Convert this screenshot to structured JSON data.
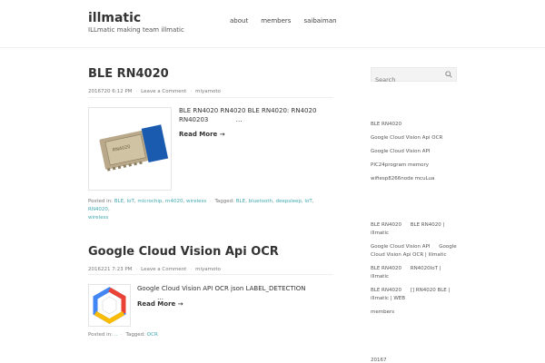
{
  "site": {
    "title": "illmatic",
    "description": "ILLmatic making team illmatic"
  },
  "nav": [
    {
      "label": "about"
    },
    {
      "label": "members"
    },
    {
      "label": "saibaiman"
    }
  ],
  "posts": [
    {
      "title": "BLE RN4020",
      "date": "2016720 6:12 PM",
      "comment": "Leave a Comment",
      "author": "miyamoto",
      "excerpt_1": "BLE RN4020 RN4020 BLE RN4020: RN4020",
      "excerpt_2": "RN40203",
      "excerpt_dots": "…",
      "more": "Read More →",
      "posted_in_label": "Posted in:",
      "categories": [
        "BLE",
        "IoT",
        "microchip",
        "rn4020",
        "wireless"
      ],
      "tagged_label": "Tagged:",
      "tags": [
        "BLE",
        "bluetooth",
        "deepsleep",
        "IoT",
        "RN4020",
        "wireless"
      ]
    },
    {
      "title": "Google Cloud Vision Api OCR",
      "date": "2016221 7:23 PM",
      "comment": "Leave a Comment",
      "author": "miyamoto",
      "excerpt_1": "Google Cloud Vision API OCR  json LABEL_DETECTION",
      "excerpt_dots": "…",
      "more": "Read More →",
      "posted_in_label": "Posted in:",
      "categories": [
        ".."
      ],
      "tagged_label": "Tagged:",
      "tags": [
        "OCR"
      ]
    }
  ],
  "sidebar": {
    "search_placeholder": "Search",
    "recent": [
      "BLE RN4020",
      "Google Cloud Vision Api OCR",
      "Google Cloud Vision API",
      "PIC24program memory",
      "wifiesp8266node mcuLua"
    ],
    "comments": [
      [
        "BLE RN4020",
        "BLE RN4020 |",
        "illmatic"
      ],
      [
        "Google Cloud Vision API",
        "Google",
        "Cloud Vision Api OCR | illmatic"
      ],
      [
        "BLE RN4020",
        "RN4020IoT |",
        "illmatic"
      ],
      [
        "BLE RN4020",
        "[] RN4020 BLE |",
        "illmatic | WEB"
      ],
      [
        "members"
      ]
    ],
    "archive_first": "20167"
  },
  "colors": {
    "accent": "#3fa9b0",
    "text": "#333333",
    "meta": "#777777"
  }
}
